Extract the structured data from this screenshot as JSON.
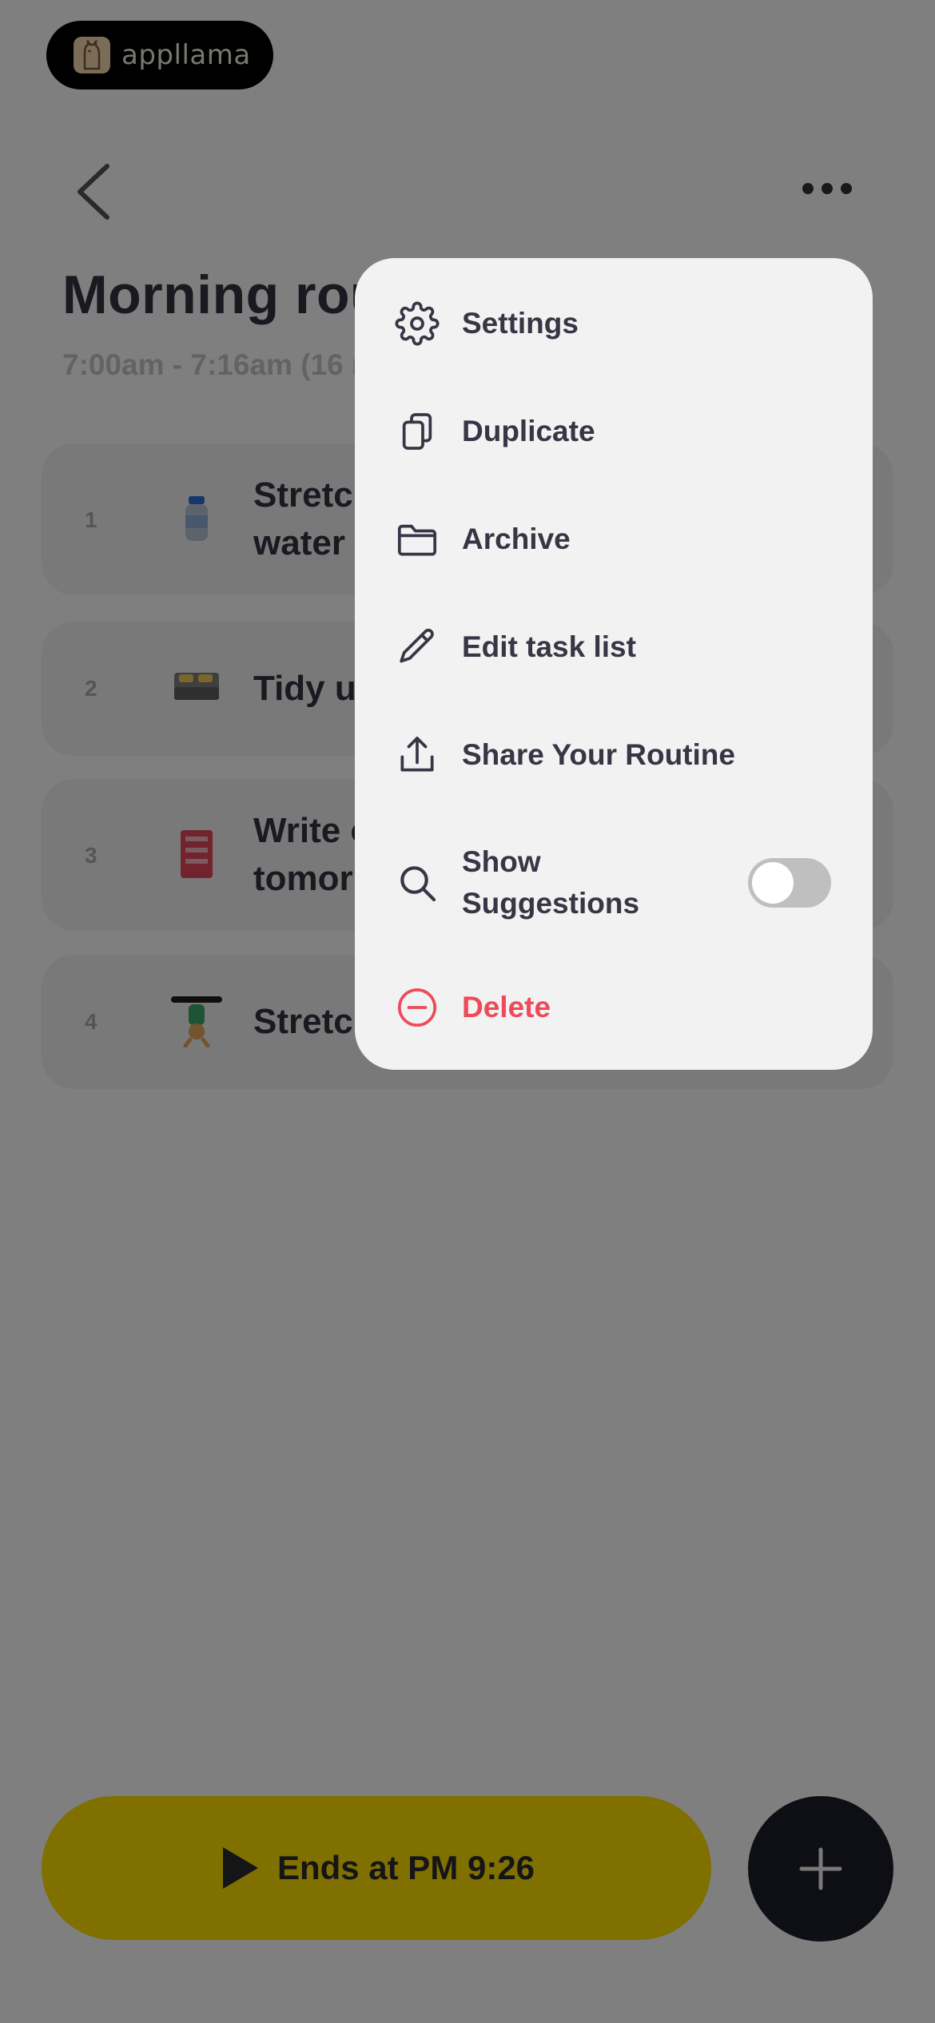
{
  "brand": {
    "name": "appllama"
  },
  "header": {
    "title": "Morning routine",
    "subtitle": "7:00am - 7:16am (16 min)"
  },
  "tasks": [
    {
      "number": "1",
      "label_line1": "Stretch & drink",
      "label_line2": "water",
      "icon": "water-bottle-icon"
    },
    {
      "number": "2",
      "label_line1": "Tidy up your bed",
      "icon": "bed-icon"
    },
    {
      "number": "3",
      "label_line1": "Write or read",
      "label_line2": "tomorrow's plan",
      "icon": "planner-icon"
    },
    {
      "number": "4",
      "label_line1": "Stretch your body",
      "icon": "stretching-person-icon"
    }
  ],
  "cta": {
    "label": "Ends at PM 9:26",
    "icon": "play-icon"
  },
  "fab": {
    "icon": "plus-icon"
  },
  "menu": {
    "items": [
      {
        "label": "Settings",
        "icon": "gear-icon"
      },
      {
        "label": "Duplicate",
        "icon": "copy-icon"
      },
      {
        "label": "Archive",
        "icon": "folder-icon"
      },
      {
        "label": "Edit task list",
        "icon": "pencil-icon"
      },
      {
        "label": "Share Your Routine",
        "icon": "share-icon"
      },
      {
        "label_line1": "Show",
        "label_line2": "Suggestions",
        "icon": "search-icon",
        "toggle_on": false
      },
      {
        "label": "Delete",
        "icon": "minus-circle-icon",
        "color": "#ee4b5a"
      }
    ]
  },
  "colors": {
    "accent": "#ffe100",
    "danger": "#ee4b5a",
    "dark": "#1c1c2a"
  }
}
